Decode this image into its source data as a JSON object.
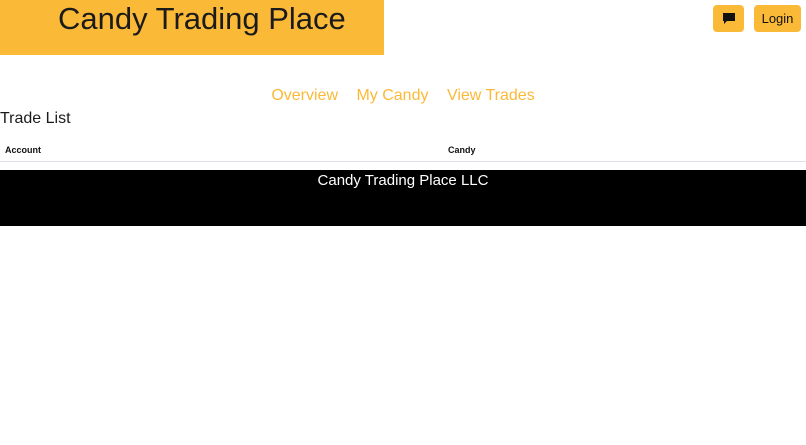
{
  "header": {
    "brand_title": "Candy Trading Place",
    "chat_icon": "chat-bubble-icon",
    "login_label": "Login"
  },
  "nav": {
    "items": [
      {
        "label": "Overview"
      },
      {
        "label": "My Candy"
      },
      {
        "label": "View Trades"
      }
    ]
  },
  "main": {
    "section_title": "Trade List",
    "table": {
      "columns": [
        "Account",
        "Candy"
      ],
      "rows": []
    }
  },
  "footer": {
    "text": "Candy Trading Place LLC"
  },
  "colors": {
    "accent": "#fbb938",
    "footer_bg": "#000000",
    "footer_text": "#ffffff"
  }
}
